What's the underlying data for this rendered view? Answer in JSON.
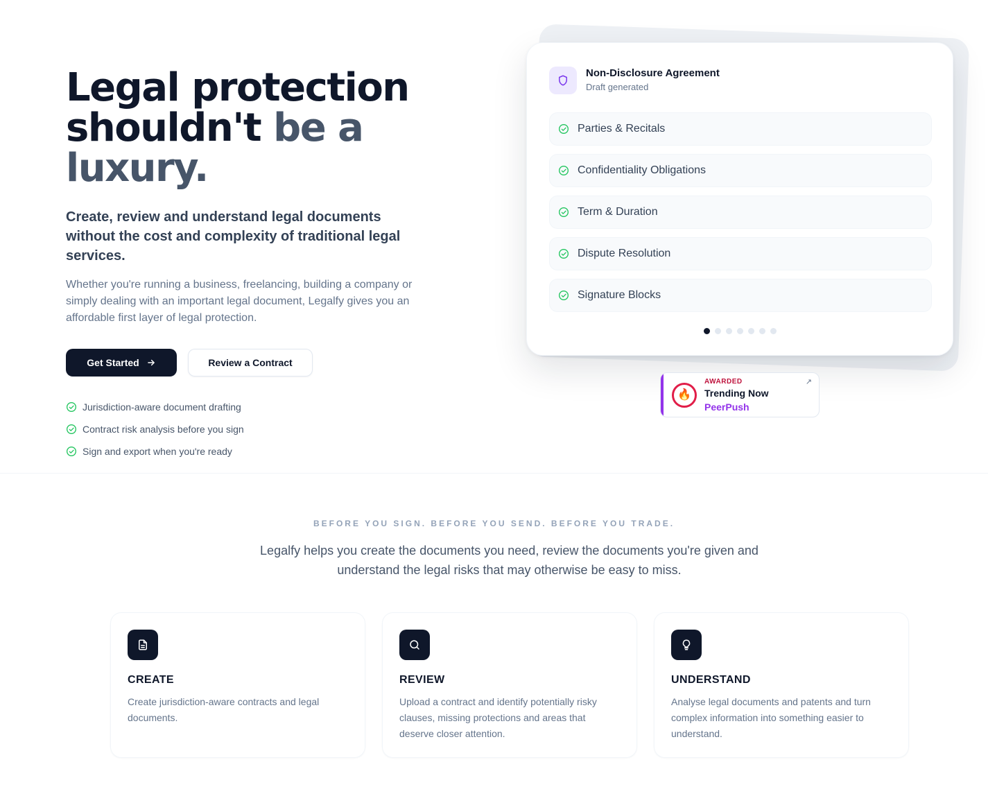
{
  "hero": {
    "headline_line1": "Legal protection",
    "headline_line2_dark": "shouldn't",
    "headline_line2_muted": "be a luxury.",
    "subhead": "Create, review and understand legal documents without the cost and complexity of traditional legal services.",
    "body": "Whether you're running a business, freelancing, building a company or simply dealing with an important legal document, Legalfy gives you an affordable first layer of legal protection.",
    "primary_button": "Get Started",
    "secondary_button": "Review a Contract",
    "features": [
      "Jurisdiction-aware document drafting",
      "Contract risk analysis before you sign",
      "Sign and export when you're ready"
    ]
  },
  "preview_card": {
    "title": "Non-Disclosure Agreement",
    "subtitle": "Draft generated",
    "sections": [
      "Parties & Recitals",
      "Confidentiality Obligations",
      "Term & Duration",
      "Dispute Resolution",
      "Signature Blocks"
    ],
    "carousel_total": 7,
    "carousel_active": 1
  },
  "badge": {
    "label": "AWARDED",
    "title": "Trending Now",
    "brand": "PeerPush"
  },
  "intro": {
    "kicker": "BEFORE YOU SIGN. BEFORE YOU SEND. BEFORE YOU TRADE.",
    "lead": "Legalfy helps you create the documents you need, review the documents you're given and understand the legal risks that may otherwise be easy to miss."
  },
  "feature_cards": [
    {
      "icon": "document-icon",
      "title": "CREATE",
      "description": "Create jurisdiction-aware contracts and legal documents."
    },
    {
      "icon": "search-icon",
      "title": "REVIEW",
      "description": "Upload a contract and identify potentially risky clauses, missing protections and areas that deserve closer attention."
    },
    {
      "icon": "lightbulb-icon",
      "title": "UNDERSTAND",
      "description": "Analyse legal documents and patents and turn complex information into something easier to understand."
    }
  ],
  "colors": {
    "primary": "#0f172a",
    "muted_heading": "#475569",
    "check": "#22c55e",
    "accent_purple": "#9333ea",
    "badge_red": "#e11d48"
  }
}
